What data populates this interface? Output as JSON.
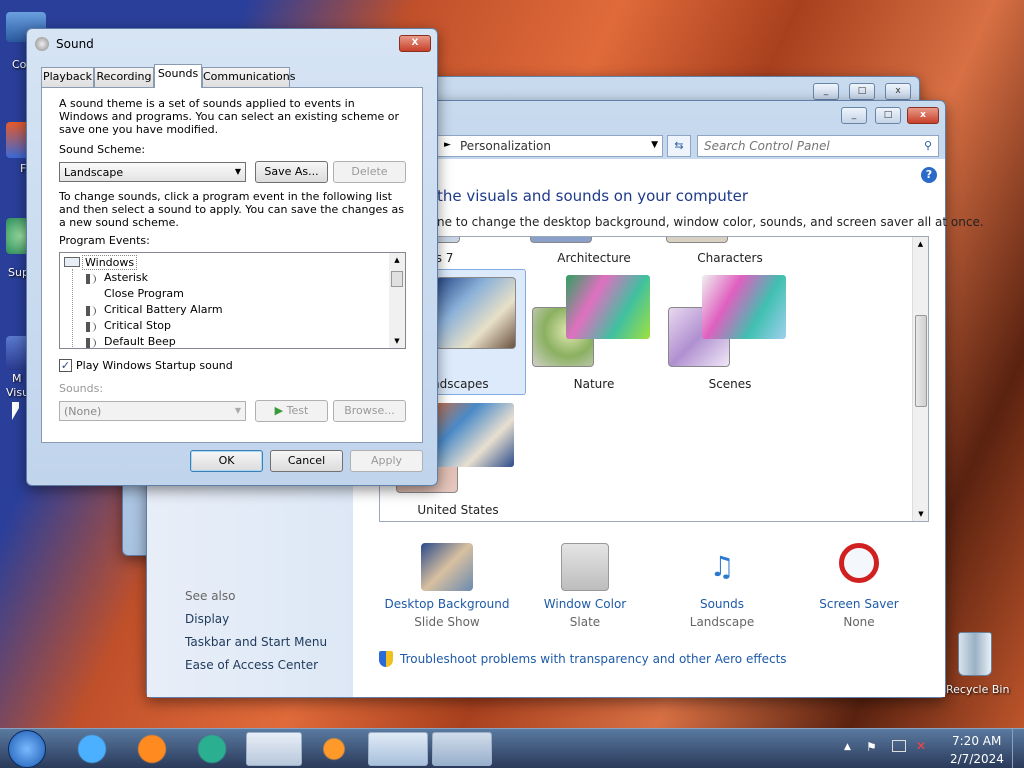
{
  "desktop": {
    "icons": [
      {
        "label": "Co"
      },
      {
        "label": "F"
      },
      {
        "label": "Sup"
      },
      {
        "label": "M"
      },
      {
        "label": "Visu"
      }
    ],
    "recycle_bin": "Recycle Bin"
  },
  "control_panel": {
    "address_path": "Personalization",
    "search_placeholder": "Search Control Panel",
    "heading": "the visuals and sounds on your computer",
    "subheading": "ne to change the desktop background, window color, sounds, and screen saver all at once.",
    "themes": [
      {
        "label": "indows 7"
      },
      {
        "label": "Architecture"
      },
      {
        "label": "Characters"
      },
      {
        "label": "ndscapes"
      },
      {
        "label": "Nature"
      },
      {
        "label": "Scenes"
      },
      {
        "label": "United States"
      }
    ],
    "bottom": [
      {
        "title": "Desktop Background",
        "sub": "Slide Show"
      },
      {
        "title": "Window Color",
        "sub": "Slate"
      },
      {
        "title": "Sounds",
        "sub": "Landscape"
      },
      {
        "title": "Screen Saver",
        "sub": "None"
      }
    ],
    "see_also": {
      "heading": "See also",
      "links": [
        "Display",
        "Taskbar and Start Menu",
        "Ease of Access Center"
      ]
    },
    "troubleshoot": "Troubleshoot problems with transparency and other Aero effects"
  },
  "sound_dialog": {
    "title": "Sound",
    "close": "X",
    "tabs": [
      "Playback",
      "Recording",
      "Sounds",
      "Communications"
    ],
    "selected_tab": "Sounds",
    "description": "A sound theme is a set of sounds applied to events in Windows and programs.  You can select an existing scheme or save one you have modified.",
    "scheme_label": "Sound Scheme:",
    "scheme_value": "Landscape",
    "save_as": "Save As...",
    "delete": "Delete",
    "instructions": "To change sounds, click a program event in the following list and then select a sound to apply.  You can save the changes as a new sound scheme.",
    "events_label": "Program Events:",
    "events_root": "Windows",
    "events": [
      "Asterisk",
      "Close Program",
      "Critical Battery Alarm",
      "Critical Stop",
      "Default Beep"
    ],
    "startup_checkbox": "Play Windows Startup sound",
    "startup_checked": true,
    "sounds_label": "Sounds:",
    "sounds_value": "(None)",
    "test": "Test",
    "browse": "Browse...",
    "ok": "OK",
    "cancel": "Cancel",
    "apply": "Apply"
  },
  "taskbar": {
    "time": "7:20 AM",
    "date": "2/7/2024"
  }
}
